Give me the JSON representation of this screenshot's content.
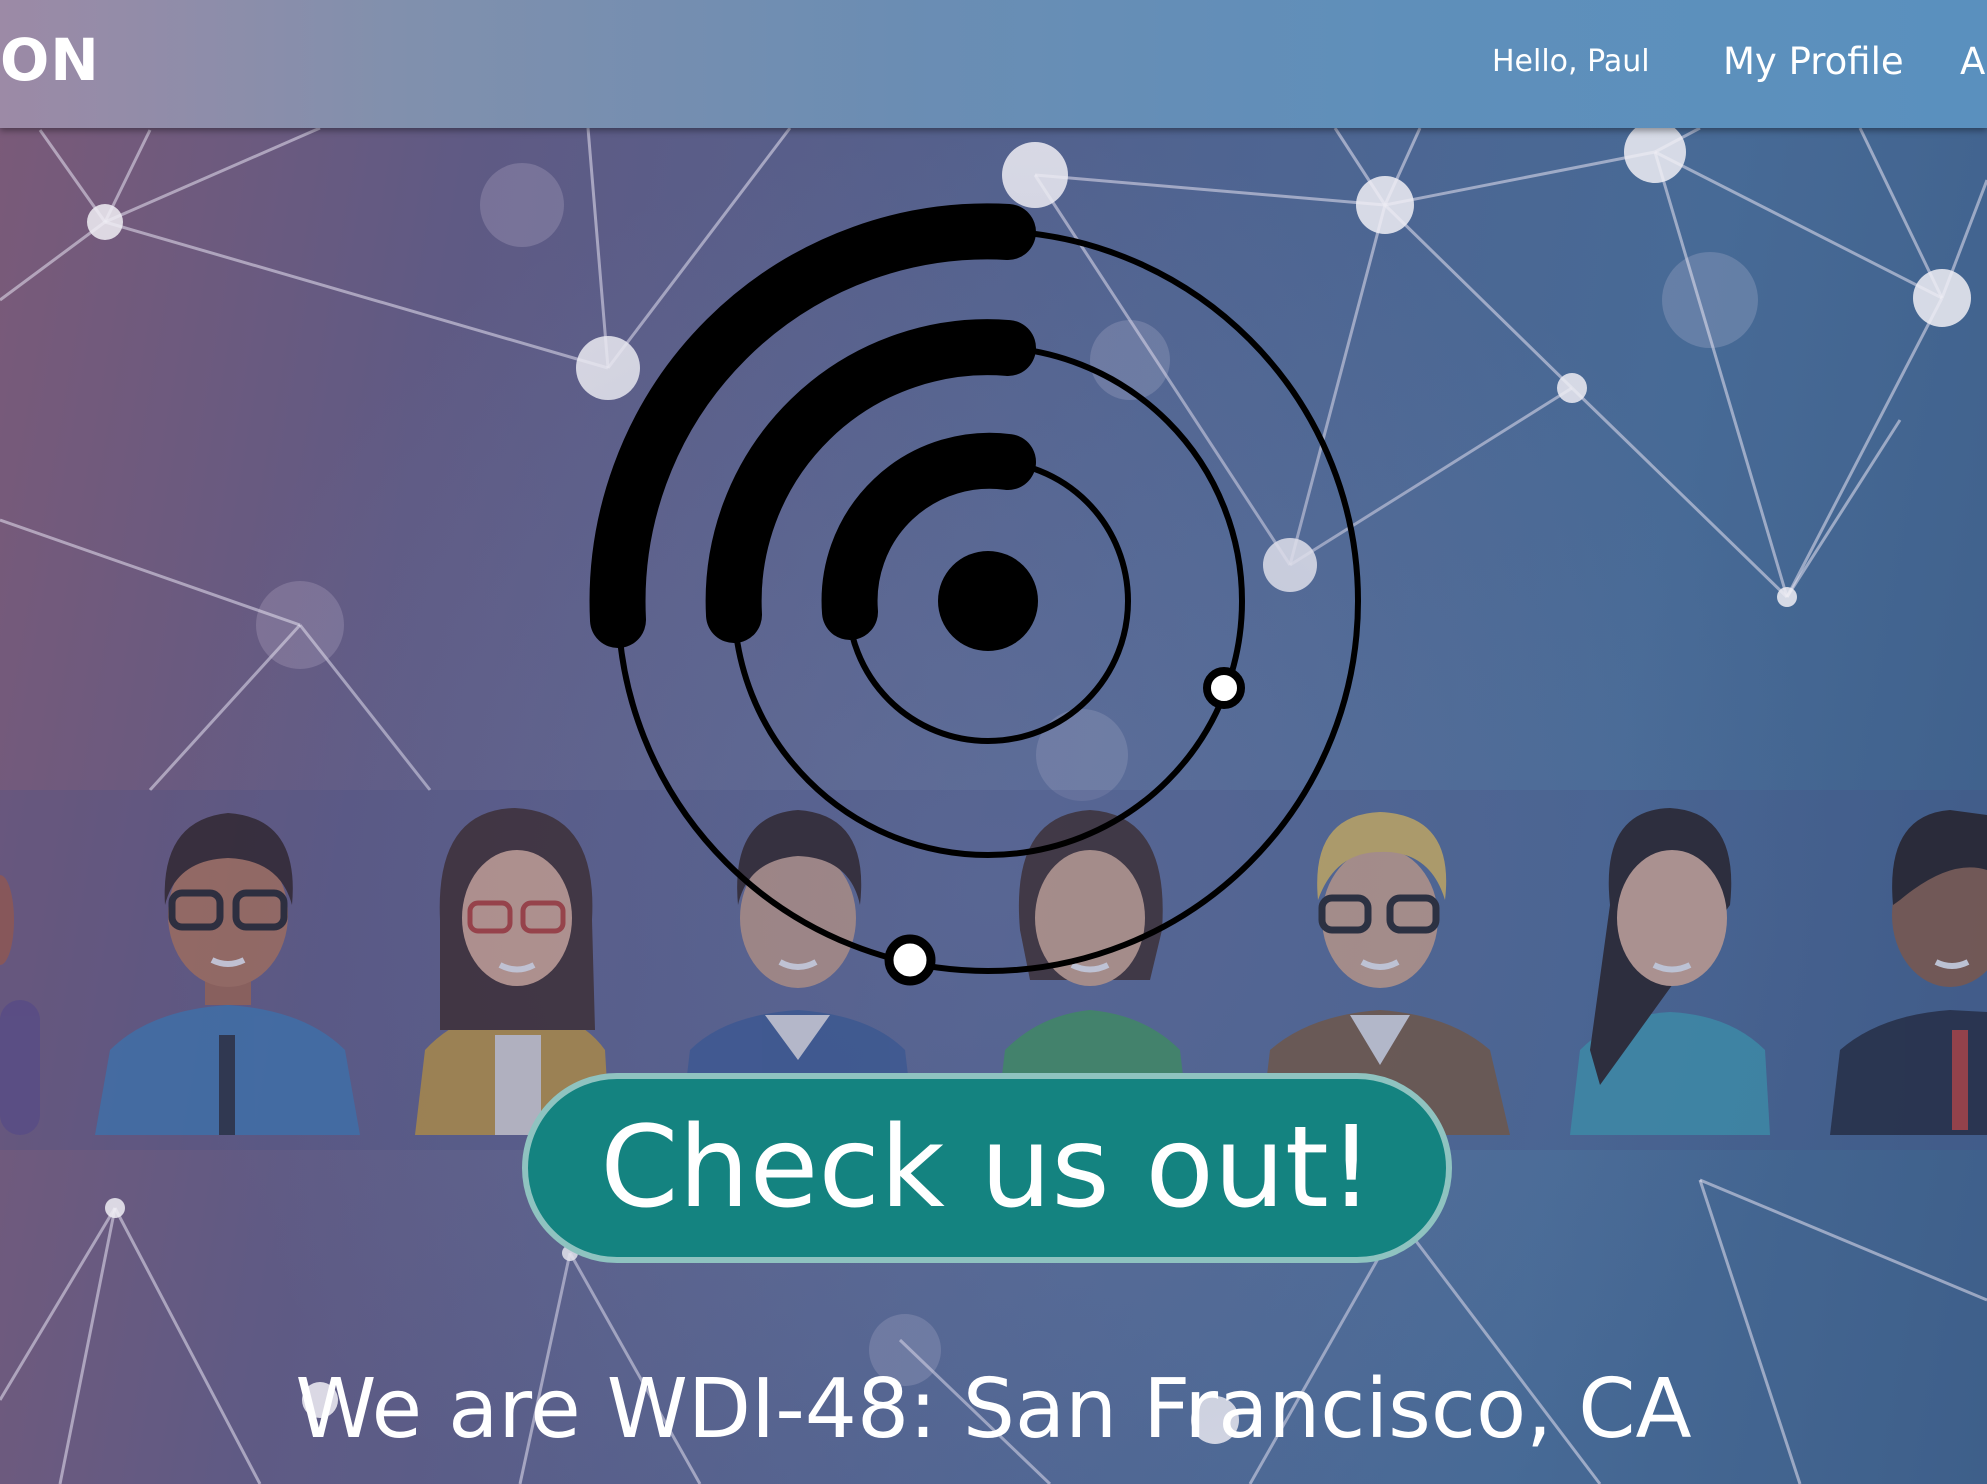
{
  "navbar": {
    "brand": "ON",
    "greeting": "Hello, Paul",
    "links": [
      {
        "label": "My Profile"
      },
      {
        "label": "A"
      }
    ]
  },
  "hero": {
    "cta_label": "Check us out!",
    "tagline": "We are WDI-48: San Francisco, CA"
  },
  "colors": {
    "cta_background": "#148380",
    "cta_border": "#8fc3c0",
    "navbar_start": "#9c8aa6",
    "navbar_end": "#5a90be"
  },
  "icons": {
    "logo": "orbit-radar-logo"
  }
}
